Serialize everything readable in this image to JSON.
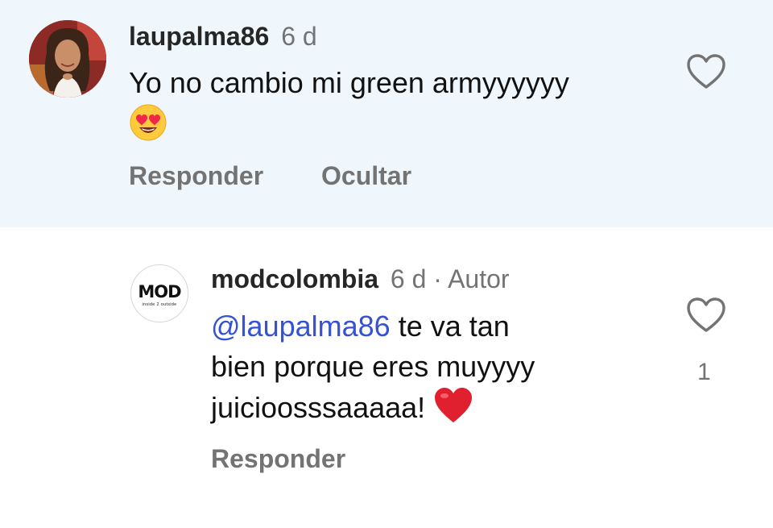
{
  "comments": [
    {
      "username": "laupalma86",
      "time": "6 d",
      "text": "Yo no cambio mi green armyyyyyy",
      "emoji": "heart-eyes",
      "actions": {
        "reply": "Responder",
        "hide": "Ocultar"
      }
    },
    {
      "username": "modcolombia",
      "time": "6 d",
      "separator": "·",
      "author_badge": "Autor",
      "mention": "@laupalma86",
      "text_line1": "te va tan",
      "text_line2": "bien porque eres muyyyy",
      "text_line3": "juicioosssaaaaa!",
      "emoji": "red-heart",
      "like_count": "1",
      "avatar_logo": "MOD",
      "avatar_tagline": "inside 2 outside",
      "actions": {
        "reply": "Responder"
      }
    }
  ],
  "colors": {
    "highlight_bg": "#eff7fc",
    "mention": "#3551d4",
    "muted": "#737373"
  }
}
